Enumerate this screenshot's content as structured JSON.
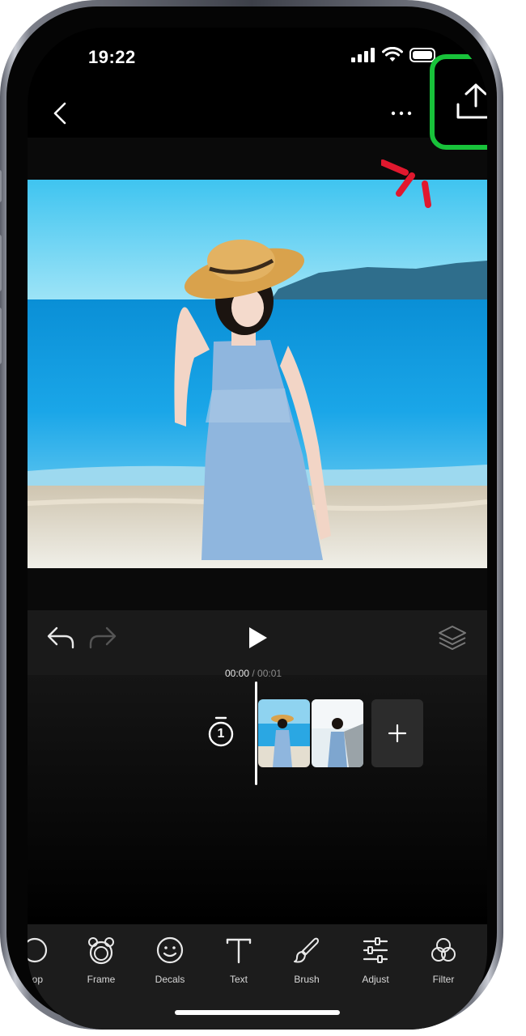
{
  "status_bar": {
    "time": "19:22"
  },
  "nav": {
    "back_icon": "chevron-left-icon",
    "more_icon": "ellipsis-icon",
    "share_icon": "share-upload-icon"
  },
  "highlight": {
    "color": "#18c23a",
    "burst_color": "#e0182e"
  },
  "playback": {
    "current_time": "00:00",
    "separator": " / ",
    "total_time": "00:01",
    "undo_icon": "undo-icon",
    "redo_icon": "redo-icon",
    "play_icon": "play-icon",
    "layers_icon": "layers-icon"
  },
  "timeline": {
    "duration_badge": "1",
    "add_icon": "plus-icon"
  },
  "tools": [
    {
      "label": "Crop",
      "icon": "crop-icon"
    },
    {
      "label": "Frame",
      "icon": "frame-icon"
    },
    {
      "label": "Decals",
      "icon": "smiley-icon"
    },
    {
      "label": "Text",
      "icon": "text-icon"
    },
    {
      "label": "Brush",
      "icon": "brush-icon"
    },
    {
      "label": "Adjust",
      "icon": "sliders-icon"
    },
    {
      "label": "Filter",
      "icon": "filter-icon"
    }
  ]
}
